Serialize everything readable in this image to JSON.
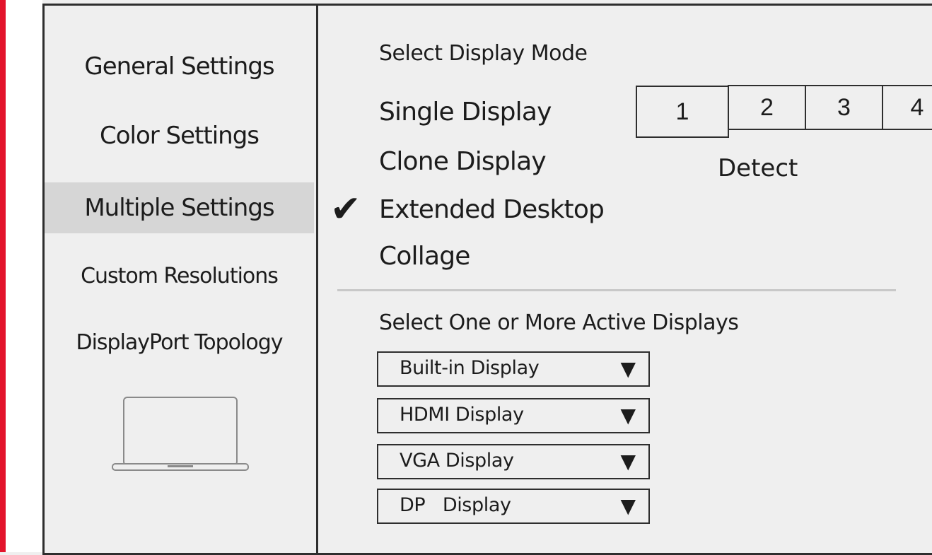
{
  "sidebar": {
    "items": [
      {
        "label": "General Settings",
        "selected": false
      },
      {
        "label": "Color Settings",
        "selected": false
      },
      {
        "label": "Multiple Settings",
        "selected": true
      },
      {
        "label": "Custom Resolutions",
        "selected": false
      },
      {
        "label": "DisplayPort Topology",
        "selected": false
      }
    ],
    "device_icon": "laptop-icon"
  },
  "display_mode": {
    "title": "Select Display Mode",
    "modes": [
      "Single Display",
      "Clone Display",
      "Extended Desktop",
      "Collage"
    ],
    "checked_mode": "Extended Desktop",
    "check_icon": "checkmark-icon",
    "displays": [
      "1",
      "2",
      "3",
      "4"
    ],
    "detect_label": "Detect"
  },
  "active_displays": {
    "title": "Select One or More Active Displays",
    "dropdowns": [
      {
        "label": "Built-in Display"
      },
      {
        "label": "HDMI Display"
      },
      {
        "label": "VGA Display"
      },
      {
        "label": "DP   Display"
      }
    ],
    "arrow": "▼"
  },
  "colors": {
    "accent_edge": "#e3142b",
    "selected_bg": "#d6d6d6",
    "border": "#2e2e2e"
  }
}
